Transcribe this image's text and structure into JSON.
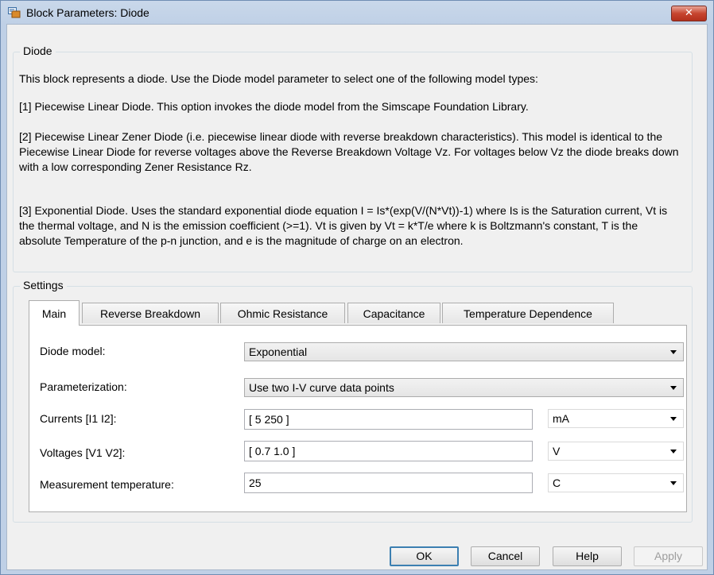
{
  "window": {
    "title": "Block Parameters: Diode",
    "close_glyph": "✕",
    "app_icon": "simulink-block-icon"
  },
  "description": {
    "group_label": "Diode",
    "paragraphs": [
      "This block represents a diode. Use the Diode model parameter to select one of the following model types:",
      "[1] Piecewise Linear Diode. This option invokes the diode model from the Simscape Foundation Library.",
      "[2] Piecewise Linear Zener Diode (i.e. piecewise linear diode with reverse breakdown characteristics). This model is identical to the Piecewise Linear Diode for reverse voltages above the Reverse Breakdown Voltage Vz. For voltages below Vz the diode breaks down with a low corresponding Zener Resistance Rz.",
      "[3] Exponential Diode. Uses the standard exponential diode equation I = Is*(exp(V/(N*Vt))-1) where Is is the Saturation current, Vt is the thermal voltage, and N is the emission coefficient (>=1). Vt is given by Vt = k*T/e where k is Boltzmann's constant, T is the absolute Temperature of the p-n junction, and e is the magnitude of charge on an electron."
    ]
  },
  "settings": {
    "group_label": "Settings",
    "tabs": [
      {
        "label": "Main",
        "active": true
      },
      {
        "label": "Reverse Breakdown",
        "active": false
      },
      {
        "label": "Ohmic Resistance",
        "active": false
      },
      {
        "label": "Capacitance",
        "active": false
      },
      {
        "label": "Temperature Dependence",
        "active": false
      }
    ],
    "params": {
      "diode_model": {
        "label": "Diode model:",
        "value": "Exponential"
      },
      "parameterization": {
        "label": "Parameterization:",
        "value": "Use two I-V curve data points"
      },
      "currents": {
        "label": "Currents [I1 I2]:",
        "value": "[ 5 250 ]",
        "unit": "mA"
      },
      "voltages": {
        "label": "Voltages [V1 V2]:",
        "value": "[ 0.7 1.0 ]",
        "unit": "V"
      },
      "temperature": {
        "label": "Measurement temperature:",
        "value": "25",
        "unit": "C"
      }
    }
  },
  "buttons": {
    "ok": "OK",
    "cancel": "Cancel",
    "help": "Help",
    "apply": "Apply"
  },
  "colors": {
    "title_bar": "#c9d8ea",
    "close_button": "#c7452f",
    "dialog_background": "#f0f0f0",
    "default_button_border": "#3c7fb1"
  }
}
